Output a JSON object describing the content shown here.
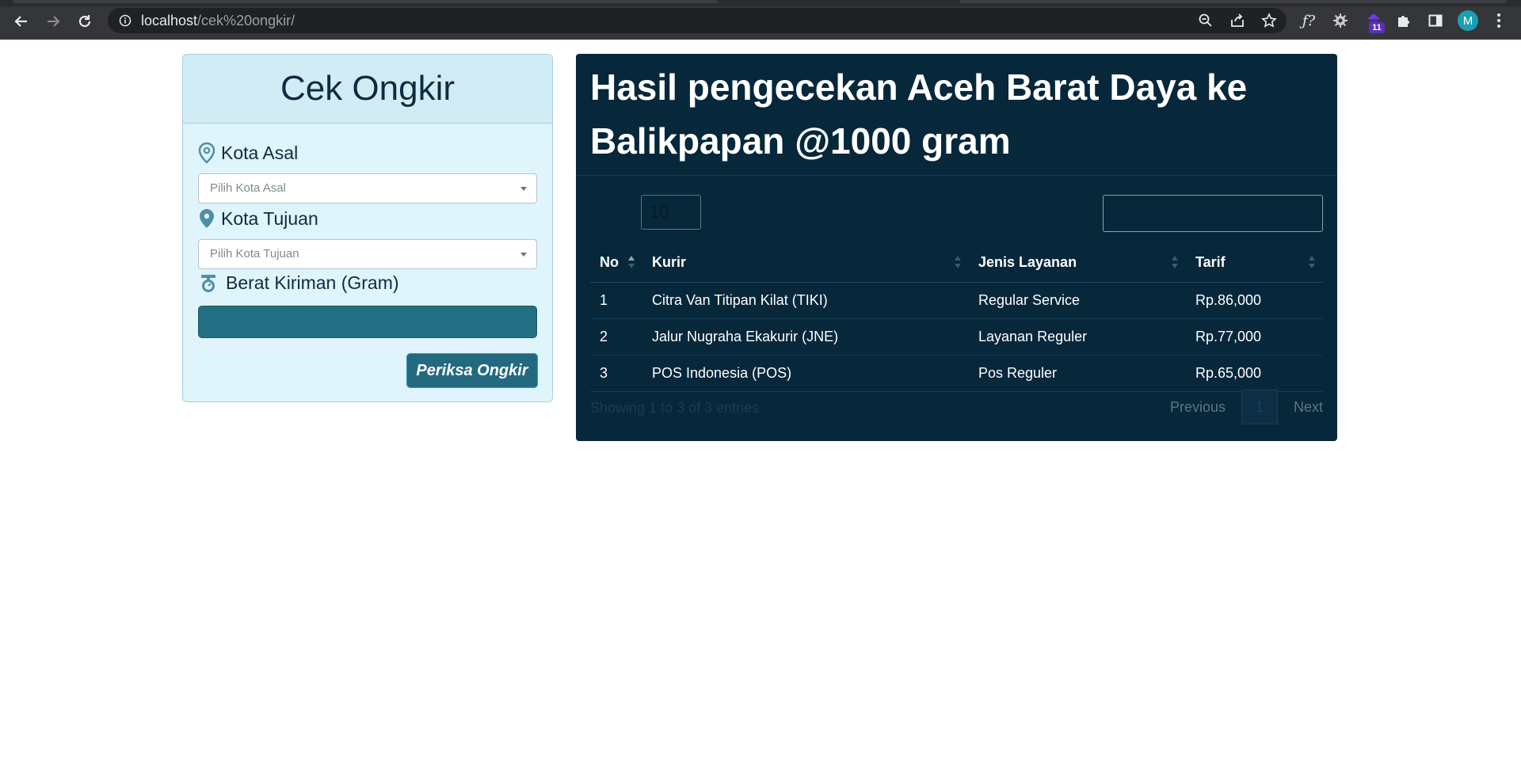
{
  "browser": {
    "url_host": "localhost",
    "url_path": "/cek%20ongkir/",
    "extension_badge": "11",
    "profile_initial": "M"
  },
  "form": {
    "title": "Cek Ongkir",
    "origin_label": "Kota Asal",
    "origin_placeholder": "Pilih Kota Asal",
    "destination_label": "Kota Tujuan",
    "destination_placeholder": "Pilih Kota Tujuan",
    "weight_label": "Berat Kiriman (Gram)",
    "weight_value": "",
    "submit_label": "Periksa Ongkir"
  },
  "results": {
    "title": "Hasil pengecekan Aceh Barat Daya ke Balikpapan @1000 gram",
    "page_length": "10",
    "search_value": "",
    "columns": [
      "No",
      "Kurir",
      "Jenis Layanan",
      "Tarif"
    ],
    "rows": [
      {
        "no": "1",
        "kurir": "Citra Van Titipan Kilat (TIKI)",
        "layanan": "Regular Service",
        "tarif": "Rp.86,000"
      },
      {
        "no": "2",
        "kurir": "Jalur Nugraha Ekakurir (JNE)",
        "layanan": "Layanan Reguler",
        "tarif": "Rp.77,000"
      },
      {
        "no": "3",
        "kurir": "POS Indonesia (POS)",
        "layanan": "Pos Reguler",
        "tarif": "Rp.65,000"
      }
    ],
    "info": "Showing 1 to 3 of 3 entries",
    "pager": {
      "previous": "Previous",
      "current": "1",
      "next": "Next"
    }
  }
}
